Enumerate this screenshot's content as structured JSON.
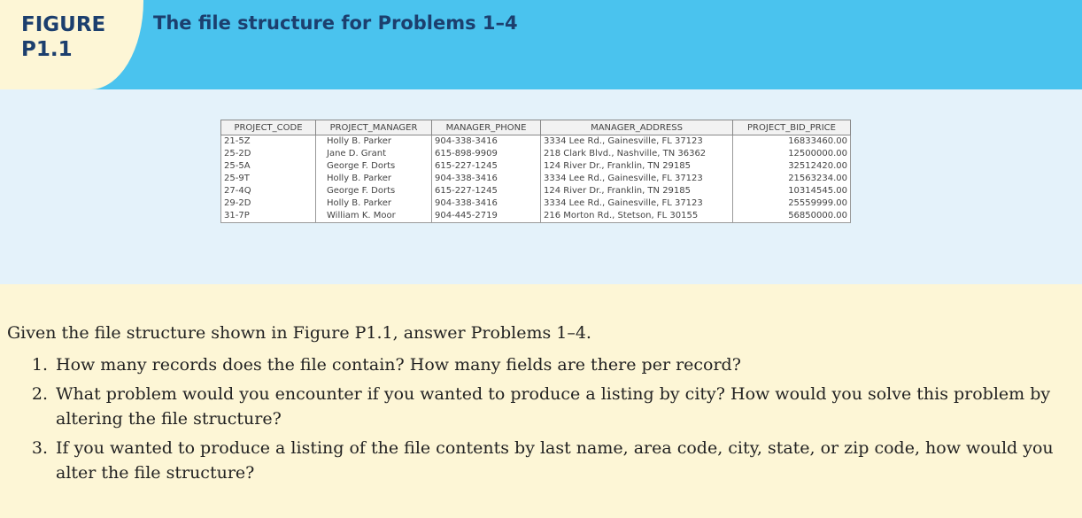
{
  "figure": {
    "label": "FIGURE",
    "number": "P1.1",
    "title": "The file structure for Problems 1–4"
  },
  "table": {
    "columns": [
      "PROJECT_CODE",
      "PROJECT_MANAGER",
      "MANAGER_PHONE",
      "MANAGER_ADDRESS",
      "PROJECT_BID_PRICE"
    ],
    "rows": [
      [
        "21-5Z",
        "Holly B. Parker",
        "904-338-3416",
        "3334 Lee Rd., Gainesville, FL  37123",
        "16833460.00"
      ],
      [
        "25-2D",
        "Jane D. Grant",
        "615-898-9909",
        "218 Clark Blvd., Nashville, TN  36362",
        "12500000.00"
      ],
      [
        "25-5A",
        "George F. Dorts",
        "615-227-1245",
        "124 River Dr., Franklin, TN  29185",
        "32512420.00"
      ],
      [
        "25-9T",
        "Holly B. Parker",
        "904-338-3416",
        "3334 Lee Rd., Gainesville, FL  37123",
        "21563234.00"
      ],
      [
        "27-4Q",
        "George F. Dorts",
        "615-227-1245",
        "124 River Dr., Franklin, TN  29185",
        "10314545.00"
      ],
      [
        "29-2D",
        "Holly B. Parker",
        "904-338-3416",
        "3334 Lee Rd., Gainesville, FL  37123",
        "25559999.00"
      ],
      [
        "31-7P",
        "William K. Moor",
        "904-445-2719",
        "216 Morton Rd., Stetson, FL  30155",
        "56850000.00"
      ]
    ]
  },
  "intro": "Given the file structure shown in Figure P1.1, answer Problems 1–4.",
  "questions": [
    {
      "num": "1.",
      "text": "How many records does the file contain? How many fields are there per record?"
    },
    {
      "num": "2.",
      "text": "What problem would you encounter if you wanted to produce a listing by city? How would you solve this problem by altering the file structure?"
    },
    {
      "num": "3.",
      "text": "If you wanted to produce a listing of the file contents by last name, area code, city, state, or zip code, how would you alter the file structure?"
    }
  ]
}
